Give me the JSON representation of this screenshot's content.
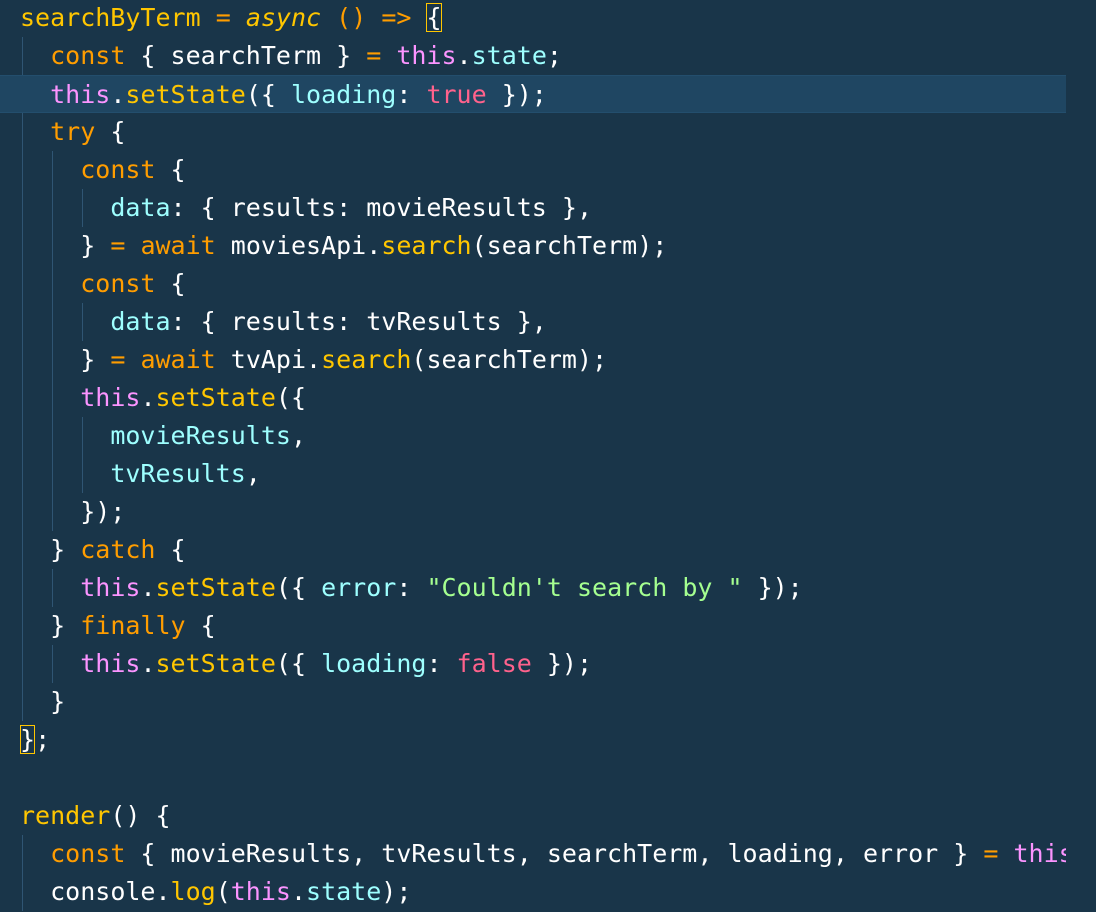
{
  "editor": {
    "language": "javascript",
    "theme_colors": {
      "background": "#193549",
      "active_line": "#1f4662",
      "function": "#ffc600",
      "keyword": "#ff9d00",
      "this": "#fb94ff",
      "property": "#9effff",
      "boolean": "#ff628c",
      "string": "#a5ff90",
      "text": "#ffffff"
    },
    "active_line_index": 2,
    "lines": [
      [
        [
          "fn",
          "searchByTerm"
        ],
        [
          "pr",
          " "
        ],
        [
          "op",
          "="
        ],
        [
          "pr",
          " "
        ],
        [
          "asy",
          "async"
        ],
        [
          "pr",
          " "
        ],
        [
          "kw",
          "()"
        ],
        [
          "pr",
          " "
        ],
        [
          "op",
          "=>"
        ],
        [
          "pr",
          " "
        ],
        [
          "bm",
          "{"
        ]
      ],
      [
        [
          "pr",
          "  "
        ],
        [
          "kw",
          "const"
        ],
        [
          "pr",
          " { "
        ],
        [
          "var",
          "searchTerm"
        ],
        [
          "pr",
          " } "
        ],
        [
          "op",
          "="
        ],
        [
          "pr",
          " "
        ],
        [
          "this",
          "this"
        ],
        [
          "pr",
          "."
        ],
        [
          "prop",
          "state"
        ],
        [
          "pr",
          ";"
        ]
      ],
      [
        [
          "pr",
          "  "
        ],
        [
          "this",
          "this"
        ],
        [
          "pr",
          "."
        ],
        [
          "fn",
          "setState"
        ],
        [
          "pr",
          "({ "
        ],
        [
          "prop",
          "loading"
        ],
        [
          "pr",
          ": "
        ],
        [
          "bool",
          "true"
        ],
        [
          "pr",
          " });"
        ]
      ],
      [
        [
          "pr",
          "  "
        ],
        [
          "kw",
          "try"
        ],
        [
          "pr",
          " {"
        ]
      ],
      [
        [
          "pr",
          "    "
        ],
        [
          "kw",
          "const"
        ],
        [
          "pr",
          " {"
        ]
      ],
      [
        [
          "pr",
          "      "
        ],
        [
          "prop",
          "data"
        ],
        [
          "pr",
          ": { "
        ],
        [
          "var",
          "results"
        ],
        [
          "pr",
          ": "
        ],
        [
          "var",
          "movieResults"
        ],
        [
          "pr",
          " },"
        ]
      ],
      [
        [
          "pr",
          "    } "
        ],
        [
          "op",
          "="
        ],
        [
          "pr",
          " "
        ],
        [
          "kw",
          "await"
        ],
        [
          "pr",
          " "
        ],
        [
          "var",
          "moviesApi"
        ],
        [
          "pr",
          "."
        ],
        [
          "fn",
          "search"
        ],
        [
          "pr",
          "("
        ],
        [
          "var",
          "searchTerm"
        ],
        [
          "pr",
          ");"
        ]
      ],
      [
        [
          "pr",
          "    "
        ],
        [
          "kw",
          "const"
        ],
        [
          "pr",
          " {"
        ]
      ],
      [
        [
          "pr",
          "      "
        ],
        [
          "prop",
          "data"
        ],
        [
          "pr",
          ": { "
        ],
        [
          "var",
          "results"
        ],
        [
          "pr",
          ": "
        ],
        [
          "var",
          "tvResults"
        ],
        [
          "pr",
          " },"
        ]
      ],
      [
        [
          "pr",
          "    } "
        ],
        [
          "op",
          "="
        ],
        [
          "pr",
          " "
        ],
        [
          "kw",
          "await"
        ],
        [
          "pr",
          " "
        ],
        [
          "var",
          "tvApi"
        ],
        [
          "pr",
          "."
        ],
        [
          "fn",
          "search"
        ],
        [
          "pr",
          "("
        ],
        [
          "var",
          "searchTerm"
        ],
        [
          "pr",
          ");"
        ]
      ],
      [
        [
          "pr",
          "    "
        ],
        [
          "this",
          "this"
        ],
        [
          "pr",
          "."
        ],
        [
          "fn",
          "setState"
        ],
        [
          "pr",
          "({"
        ]
      ],
      [
        [
          "pr",
          "      "
        ],
        [
          "prop",
          "movieResults"
        ],
        [
          "pr",
          ","
        ]
      ],
      [
        [
          "pr",
          "      "
        ],
        [
          "prop",
          "tvResults"
        ],
        [
          "pr",
          ","
        ]
      ],
      [
        [
          "pr",
          "    });"
        ]
      ],
      [
        [
          "pr",
          "  } "
        ],
        [
          "kw",
          "catch"
        ],
        [
          "pr",
          " {"
        ]
      ],
      [
        [
          "pr",
          "    "
        ],
        [
          "this",
          "this"
        ],
        [
          "pr",
          "."
        ],
        [
          "fn",
          "setState"
        ],
        [
          "pr",
          "({ "
        ],
        [
          "prop",
          "error"
        ],
        [
          "pr",
          ": "
        ],
        [
          "str",
          "\"Couldn't search by \""
        ],
        [
          "pr",
          " });"
        ]
      ],
      [
        [
          "pr",
          "  } "
        ],
        [
          "kw",
          "finally"
        ],
        [
          "pr",
          " {"
        ]
      ],
      [
        [
          "pr",
          "    "
        ],
        [
          "this",
          "this"
        ],
        [
          "pr",
          "."
        ],
        [
          "fn",
          "setState"
        ],
        [
          "pr",
          "({ "
        ],
        [
          "prop",
          "loading"
        ],
        [
          "pr",
          ": "
        ],
        [
          "bool",
          "false"
        ],
        [
          "pr",
          " });"
        ]
      ],
      [
        [
          "pr",
          "  }"
        ]
      ],
      [
        [
          "bm",
          "}"
        ],
        [
          "pr",
          ";"
        ]
      ],
      [],
      [
        [
          "fn",
          "render"
        ],
        [
          "pr",
          "() {"
        ]
      ],
      [
        [
          "pr",
          "  "
        ],
        [
          "kw",
          "const"
        ],
        [
          "pr",
          " { "
        ],
        [
          "var",
          "movieResults"
        ],
        [
          "pr",
          ", "
        ],
        [
          "var",
          "tvResults"
        ],
        [
          "pr",
          ", "
        ],
        [
          "var",
          "searchTerm"
        ],
        [
          "pr",
          ", "
        ],
        [
          "var",
          "loading"
        ],
        [
          "pr",
          ", "
        ],
        [
          "var",
          "error"
        ],
        [
          "pr",
          " } "
        ],
        [
          "op",
          "="
        ],
        [
          "pr",
          " "
        ],
        [
          "this",
          "this"
        ]
      ],
      [
        [
          "pr",
          "  "
        ],
        [
          "var",
          "console"
        ],
        [
          "pr",
          "."
        ],
        [
          "fn",
          "log"
        ],
        [
          "pr",
          "("
        ],
        [
          "this",
          "this"
        ],
        [
          "pr",
          "."
        ],
        [
          "prop",
          "state"
        ],
        [
          "pr",
          ");"
        ]
      ]
    ]
  }
}
